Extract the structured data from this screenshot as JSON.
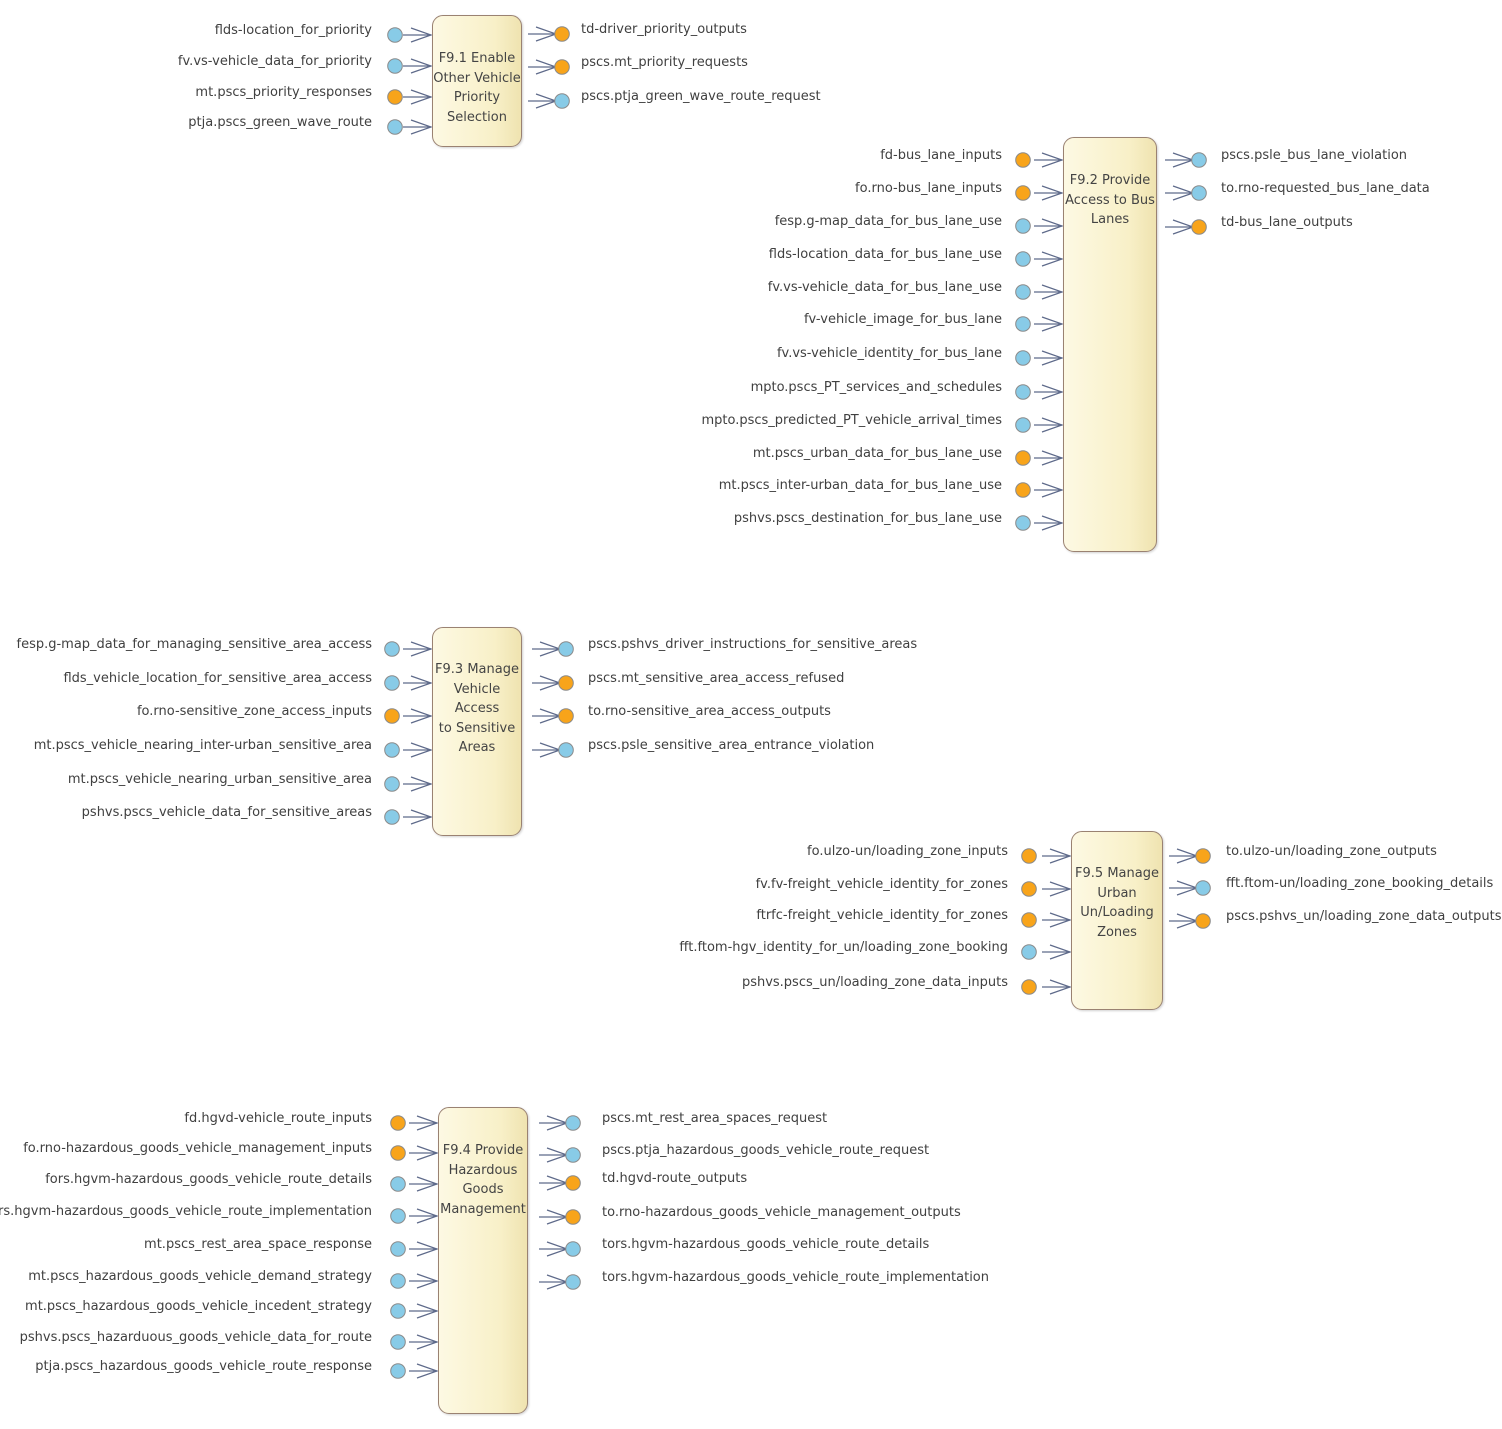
{
  "colors": {
    "blue_port": "#88cbe7",
    "orange_port": "#f8a41a",
    "port_outline": "#8a8a8a",
    "box_border": "#9a8272",
    "connector": "#5e6a8a",
    "text": "#404040"
  },
  "functions": [
    {
      "id": "f91",
      "title": "F9.1 Enable\nOther Vehicle\nPriority\nSelection",
      "inputs": [
        {
          "label": "flds-location_for_priority",
          "port": "blue"
        },
        {
          "label": "fv.vs-vehicle_data_for_priority",
          "port": "blue"
        },
        {
          "label": "mt.pscs_priority_responses",
          "port": "orange"
        },
        {
          "label": "ptja.pscs_green_wave_route",
          "port": "blue"
        }
      ],
      "outputs": [
        {
          "label": "td-driver_priority_outputs",
          "port": "orange"
        },
        {
          "label": "pscs.mt_priority_requests",
          "port": "orange"
        },
        {
          "label": "pscs.ptja_green_wave_route_request",
          "port": "blue"
        }
      ]
    },
    {
      "id": "f92",
      "title": "F9.2 Provide\nAccess to Bus\nLanes",
      "inputs": [
        {
          "label": "fd-bus_lane_inputs",
          "port": "orange"
        },
        {
          "label": "fo.rno-bus_lane_inputs",
          "port": "orange"
        },
        {
          "label": "fesp.g-map_data_for_bus_lane_use",
          "port": "blue"
        },
        {
          "label": "flds-location_data_for_bus_lane_use",
          "port": "blue"
        },
        {
          "label": "fv.vs-vehicle_data_for_bus_lane_use",
          "port": "blue"
        },
        {
          "label": "fv-vehicle_image_for_bus_lane",
          "port": "blue"
        },
        {
          "label": "fv.vs-vehicle_identity_for_bus_lane",
          "port": "blue"
        },
        {
          "label": "mpto.pscs_PT_services_and_schedules",
          "port": "blue"
        },
        {
          "label": "mpto.pscs_predicted_PT_vehicle_arrival_times",
          "port": "blue"
        },
        {
          "label": "mt.pscs_urban_data_for_bus_lane_use",
          "port": "orange"
        },
        {
          "label": "mt.pscs_inter-urban_data_for_bus_lane_use",
          "port": "orange"
        },
        {
          "label": "pshvs.pscs_destination_for_bus_lane_use",
          "port": "blue"
        }
      ],
      "outputs": [
        {
          "label": "pscs.psle_bus_lane_violation",
          "port": "blue"
        },
        {
          "label": "to.rno-requested_bus_lane_data",
          "port": "blue"
        },
        {
          "label": "td-bus_lane_outputs",
          "port": "orange"
        }
      ]
    },
    {
      "id": "f93",
      "title": "F9.3 Manage\nVehicle Access\nto Sensitive\nAreas",
      "inputs": [
        {
          "label": "fesp.g-map_data_for_managing_sensitive_area_access",
          "port": "blue"
        },
        {
          "label": "flds_vehicle_location_for_sensitive_area_access",
          "port": "blue"
        },
        {
          "label": "fo.rno-sensitive_zone_access_inputs",
          "port": "orange"
        },
        {
          "label": "mt.pscs_vehicle_nearing_inter-urban_sensitive_area",
          "port": "blue"
        },
        {
          "label": "mt.pscs_vehicle_nearing_urban_sensitive_area",
          "port": "blue"
        },
        {
          "label": "pshvs.pscs_vehicle_data_for_sensitive_areas",
          "port": "blue"
        }
      ],
      "outputs": [
        {
          "label": "pscs.pshvs_driver_instructions_for_sensitive_areas",
          "port": "blue"
        },
        {
          "label": "pscs.mt_sensitive_area_access_refused",
          "port": "orange"
        },
        {
          "label": "to.rno-sensitive_area_access_outputs",
          "port": "orange"
        },
        {
          "label": "pscs.psle_sensitive_area_entrance_violation",
          "port": "blue"
        }
      ]
    },
    {
      "id": "f95",
      "title": "F9.5 Manage\nUrban\nUn/Loading\nZones",
      "inputs": [
        {
          "label": "fo.ulzo-un/loading_zone_inputs",
          "port": "orange"
        },
        {
          "label": "fv.fv-freight_vehicle_identity_for_zones",
          "port": "orange"
        },
        {
          "label": "ftrfc-freight_vehicle_identity_for_zones",
          "port": "orange"
        },
        {
          "label": "fft.ftom-hgv_identity_for_un/loading_zone_booking",
          "port": "blue"
        },
        {
          "label": "pshvs.pscs_un/loading_zone_data_inputs",
          "port": "orange"
        }
      ],
      "outputs": [
        {
          "label": "to.ulzo-un/loading_zone_outputs",
          "port": "orange"
        },
        {
          "label": "fft.ftom-un/loading_zone_booking_details",
          "port": "blue"
        },
        {
          "label": "pscs.pshvs_un/loading_zone_data_outputs",
          "port": "orange"
        }
      ]
    },
    {
      "id": "f94",
      "title": "F9.4 Provide\nHazardous\nGoods\nManagement",
      "inputs": [
        {
          "label": "fd.hgvd-vehicle_route_inputs",
          "port": "orange"
        },
        {
          "label": "fo.rno-hazardous_goods_vehicle_management_inputs",
          "port": "orange"
        },
        {
          "label": "fors.hgvm-hazardous_goods_vehicle_route_details",
          "port": "blue"
        },
        {
          "label": "fors.hgvm-hazardous_goods_vehicle_route_implementation",
          "port": "blue"
        },
        {
          "label": "mt.pscs_rest_area_space_response",
          "port": "blue"
        },
        {
          "label": "mt.pscs_hazardous_goods_vehicle_demand_strategy",
          "port": "blue"
        },
        {
          "label": "mt.pscs_hazardous_goods_vehicle_incedent_strategy",
          "port": "blue"
        },
        {
          "label": "pshvs.pscs_hazarduous_goods_vehicle_data_for_route",
          "port": "blue"
        },
        {
          "label": "ptja.pscs_hazardous_goods_vehicle_route_response",
          "port": "blue"
        }
      ],
      "outputs": [
        {
          "label": "pscs.mt_rest_area_spaces_request",
          "port": "blue"
        },
        {
          "label": "pscs.ptja_hazardous_goods_vehicle_route_request",
          "port": "blue"
        },
        {
          "label": "td.hgvd-route_outputs",
          "port": "orange"
        },
        {
          "label": "to.rno-hazardous_goods_vehicle_management_outputs",
          "port": "orange"
        },
        {
          "label": "tors.hgvm-hazardous_goods_vehicle_route_details",
          "port": "blue"
        },
        {
          "label": "tors.hgvm-hazardous_goods_vehicle_route_implementation",
          "port": "blue"
        }
      ]
    }
  ]
}
